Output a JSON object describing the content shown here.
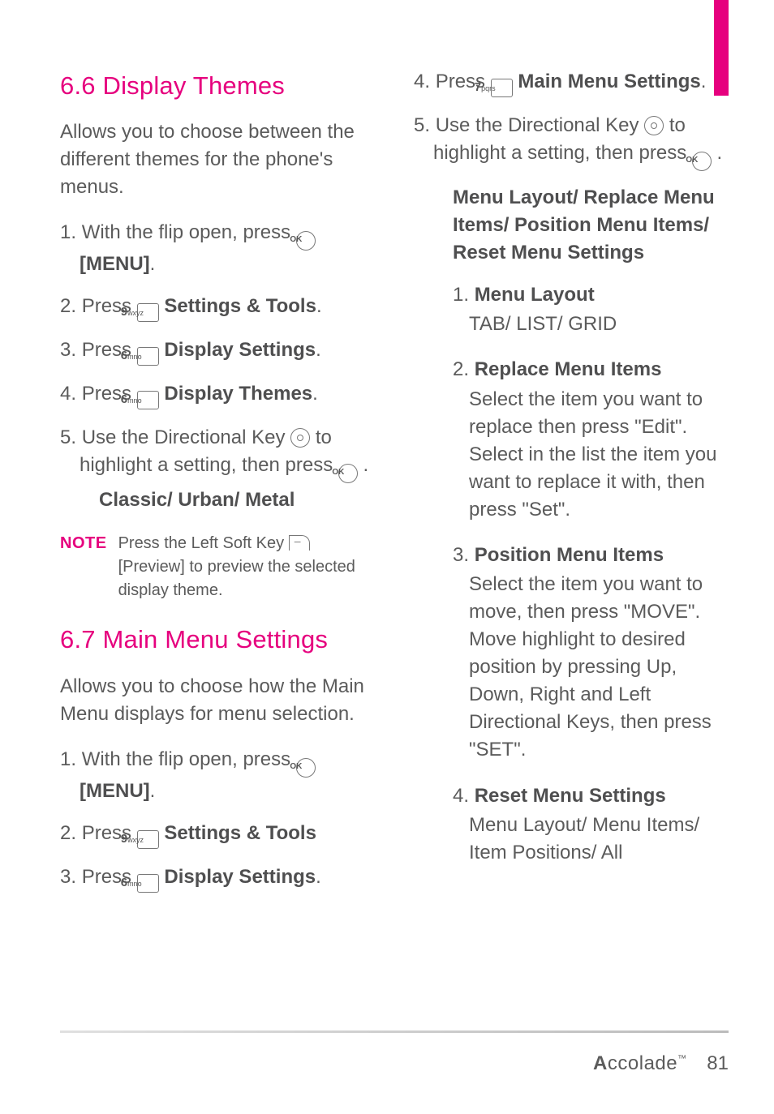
{
  "left": {
    "h66": "6.6 Display Themes",
    "intro66": "Allows you to choose between the different themes for the phone's menus.",
    "s66": [
      {
        "n": "1.",
        "a": "With the flip open, press",
        "b": "[MENU]"
      },
      {
        "n": "2.",
        "a": "Press",
        "b": "Settings & Tools"
      },
      {
        "n": "3.",
        "a": "Press",
        "b": "Display Settings"
      },
      {
        "n": "4.",
        "a": "Press",
        "b": "Display Themes"
      },
      {
        "n": "5.",
        "a": "Use the Directional Key",
        "c": "to highlight a setting, then press"
      }
    ],
    "opts66": "Classic/ Urban/ Metal",
    "note": {
      "lbl": "NOTE",
      "a": "Press the Left Soft Key",
      "b": "[Preview] to preview the selected display theme."
    },
    "h67": "6.7 Main Menu Settings",
    "intro67": "Allows you to choose how the Main Menu displays for menu selection.",
    "s67": [
      {
        "n": "1.",
        "a": "With the flip open, press",
        "b": "[MENU]"
      },
      {
        "n": "2.",
        "a": "Press",
        "b": "Settings & Tools"
      },
      {
        "n": "3.",
        "a": "Press",
        "b": "Display Settings"
      }
    ]
  },
  "right": {
    "s": [
      {
        "n": "4.",
        "a": "Press",
        "b": "Main Menu Settings"
      },
      {
        "n": "5.",
        "a": "Use the Directional Key",
        "c": "to highlight a setting, then press"
      }
    ],
    "menuopts": "Menu Layout/ Replace Menu Items/ Position Menu Items/ Reset Menu Settings",
    "sub": [
      {
        "n": "1.",
        "t": "Menu Layout",
        "d": "TAB/ LIST/ GRID"
      },
      {
        "n": "2.",
        "t": "Replace Menu Items",
        "d": "Select the item you want to replace then press \"Edit\". Select in the list the item you want to replace it with, then press \"Set\"."
      },
      {
        "n": "3.",
        "t": "Position Menu Items",
        "d": "Select the item you want to move, then press \"MOVE\". Move highlight to desired position by pressing Up, Down, Right and Left Directional Keys, then press \"SET\"."
      },
      {
        "n": "4.",
        "t": "Reset Menu Settings",
        "d": "Menu Layout/ Menu Items/ Item Positions/ All"
      }
    ]
  },
  "footer": {
    "brandA": "A",
    "brandB": "ccolade",
    "tm": "™",
    "page": "81"
  }
}
